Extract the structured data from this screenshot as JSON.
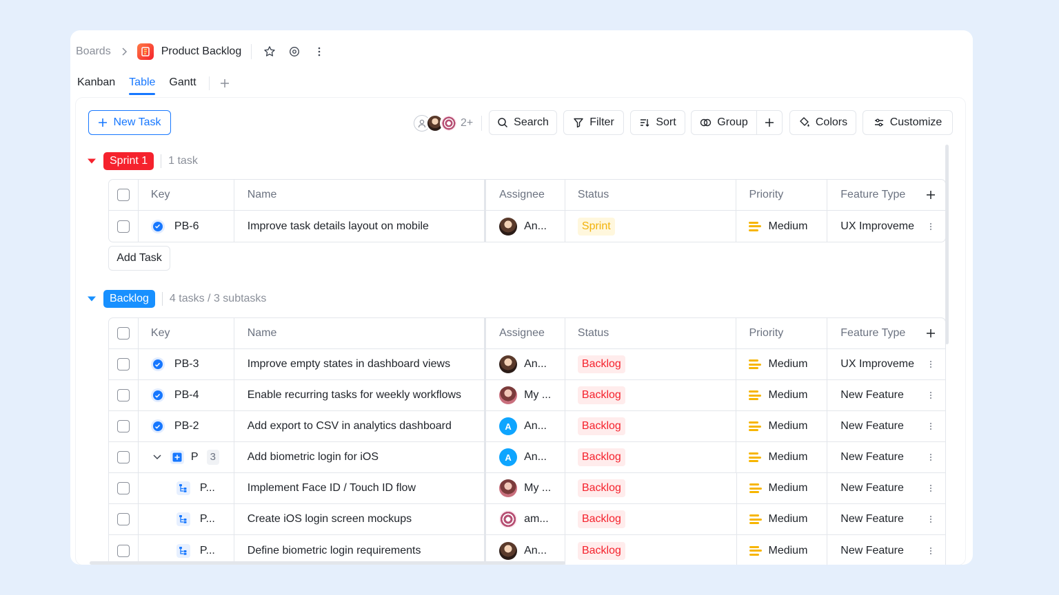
{
  "breadcrumb": {
    "root": "Boards",
    "project": "Product Backlog"
  },
  "tabs": [
    {
      "label": "Kanban"
    },
    {
      "label": "Table"
    },
    {
      "label": "Gantt"
    }
  ],
  "toolbar": {
    "new_task": "New Task",
    "members_more": "2+",
    "search": "Search",
    "filter": "Filter",
    "sort": "Sort",
    "group": "Group",
    "colors": "Colors",
    "customize": "Customize"
  },
  "columns": {
    "key": "Key",
    "name": "Name",
    "assignee": "Assignee",
    "status": "Status",
    "priority": "Priority",
    "feature_type": "Feature Type"
  },
  "groups": {
    "sprint": {
      "label": "Sprint 1",
      "meta": "1 task",
      "color": "#f5222d",
      "rows": [
        {
          "key": "PB-6",
          "name": "Improve task details layout on mobile",
          "assignee": "An...",
          "status": "Sprint",
          "priority": "Medium",
          "feature_type": "UX Improveme"
        }
      ],
      "add_task": "Add Task"
    },
    "backlog": {
      "label": "Backlog",
      "meta": "4 tasks / 3 subtasks",
      "color": "#1890ff",
      "rows": [
        {
          "key": "PB-3",
          "name": "Improve empty states in dashboard views",
          "assignee": "An...",
          "status": "Backlog",
          "priority": "Medium",
          "feature_type": "UX Improveme"
        },
        {
          "key": "PB-4",
          "name": "Enable recurring tasks for weekly workflows",
          "assignee": "My ...",
          "status": "Backlog",
          "priority": "Medium",
          "feature_type": "New Feature"
        },
        {
          "key": "PB-2",
          "name": "Add export to CSV in analytics dashboard",
          "assignee": "An...",
          "status": "Backlog",
          "priority": "Medium",
          "feature_type": "New Feature"
        },
        {
          "key": "P",
          "subtask_count": "3",
          "name": "Add biometric login for iOS",
          "assignee": "An...",
          "status": "Backlog",
          "priority": "Medium",
          "feature_type": "New Feature"
        },
        {
          "key": "P...",
          "name": "Implement Face ID / Touch ID flow",
          "assignee": "My ...",
          "status": "Backlog",
          "priority": "Medium",
          "feature_type": "New Feature"
        },
        {
          "key": "P...",
          "name": "Create iOS login screen mockups",
          "assignee": "am...",
          "status": "Backlog",
          "priority": "Medium",
          "feature_type": "New Feature"
        },
        {
          "key": "P...",
          "name": "Define biometric login requirements",
          "assignee": "An...",
          "status": "Backlog",
          "priority": "Medium",
          "feature_type": "New Feature"
        }
      ]
    }
  },
  "avatar_letter": "A"
}
